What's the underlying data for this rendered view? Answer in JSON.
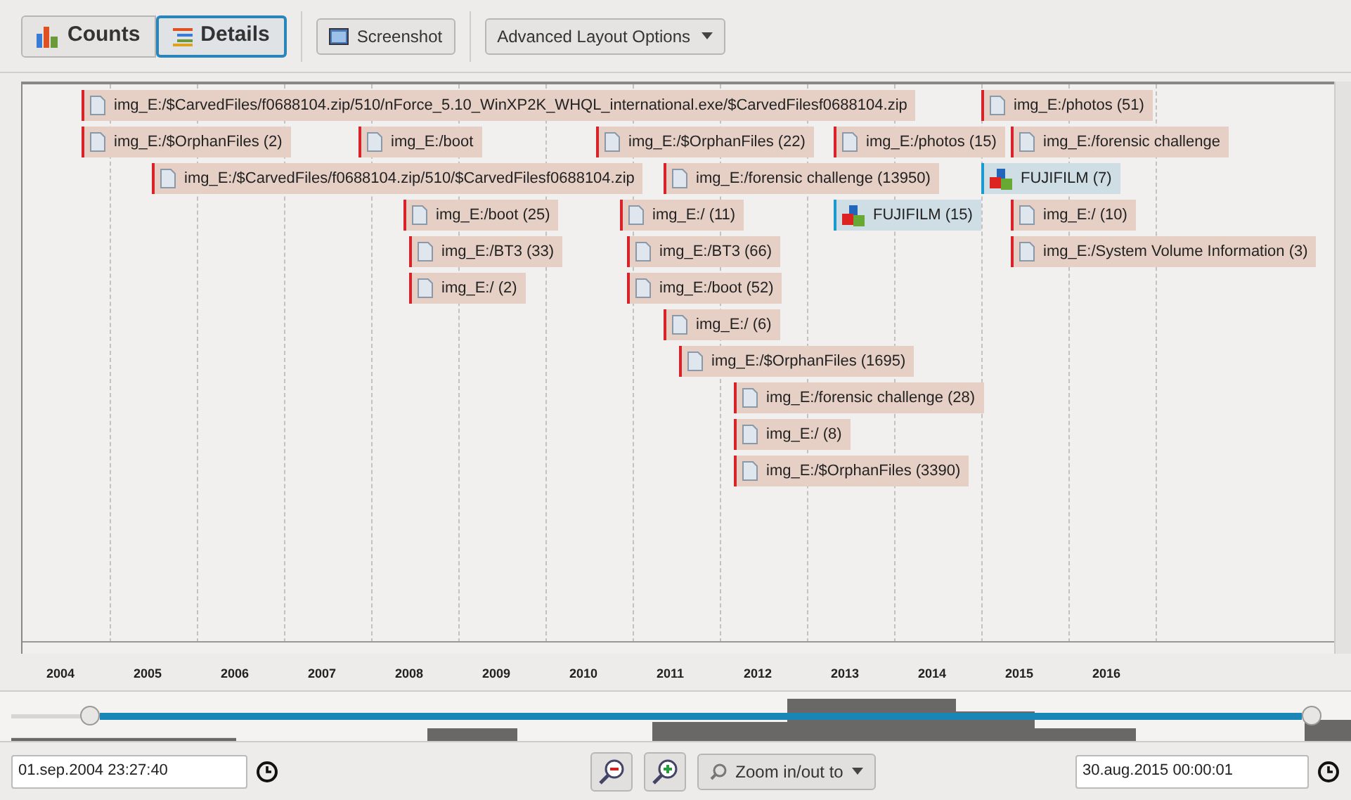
{
  "toolbar": {
    "view_modes": [
      {
        "label": "Counts",
        "selected": false
      },
      {
        "label": "Details",
        "selected": true
      }
    ],
    "screenshot_button": "Screenshot",
    "layout_dropdown": "Advanced Layout Options"
  },
  "events": [
    {
      "kind": "file",
      "label": "img_E:/$CarvedFiles/f0688104.zip/510/nForce_5.10_WinXP2K_WHQL_international.exe/$CarvedFilesf0688104.zip"
    },
    {
      "kind": "file",
      "label": "img_E:/photos (51)"
    },
    {
      "kind": "file",
      "label": "img_E:/$OrphanFiles (2)"
    },
    {
      "kind": "file",
      "label": "img_E:/boot"
    },
    {
      "kind": "file",
      "label": "img_E:/$OrphanFiles (22)"
    },
    {
      "kind": "file",
      "label": "img_E:/photos (15)"
    },
    {
      "kind": "file",
      "label": "img_E:/forensic challenge"
    },
    {
      "kind": "file",
      "label": "img_E:/$CarvedFiles/f0688104.zip/510/$CarvedFilesf0688104.zip"
    },
    {
      "kind": "file",
      "label": "img_E:/forensic challenge (13950)"
    },
    {
      "kind": "camera",
      "label": "FUJIFILM (7)"
    },
    {
      "kind": "file",
      "label": "img_E:/boot (25)"
    },
    {
      "kind": "file",
      "label": "img_E:/ (11)"
    },
    {
      "kind": "camera",
      "label": "FUJIFILM (15)"
    },
    {
      "kind": "file",
      "label": "img_E:/ (10)"
    },
    {
      "kind": "file",
      "label": "img_E:/BT3 (33)"
    },
    {
      "kind": "file",
      "label": "img_E:/BT3 (66)"
    },
    {
      "kind": "file",
      "label": "img_E:/System Volume Information (3)"
    },
    {
      "kind": "file",
      "label": "img_E:/ (2)"
    },
    {
      "kind": "file",
      "label": "img_E:/boot (52)"
    },
    {
      "kind": "file",
      "label": "img_E:/ (6)"
    },
    {
      "kind": "file",
      "label": "img_E:/$OrphanFiles (1695)"
    },
    {
      "kind": "file",
      "label": "img_E:/forensic challenge (28)"
    },
    {
      "kind": "file",
      "label": "img_E:/ (8)"
    },
    {
      "kind": "file",
      "label": "img_E:/$OrphanFiles (3390)"
    }
  ],
  "years": [
    "2004",
    "2005",
    "2006",
    "2007",
    "2008",
    "2009",
    "2010",
    "2011",
    "2012",
    "2013",
    "2014",
    "2015",
    "2016"
  ],
  "range_slider": {
    "thumbs": [
      {
        "level": 0.06
      },
      {
        "level": 1
      }
    ]
  },
  "bottom_bar": {
    "start_time": "01.sep.2004 23:27:40",
    "zoom_dropdown": "Zoom in/out to",
    "end_time": "30.aug.2015 00:00:01"
  }
}
